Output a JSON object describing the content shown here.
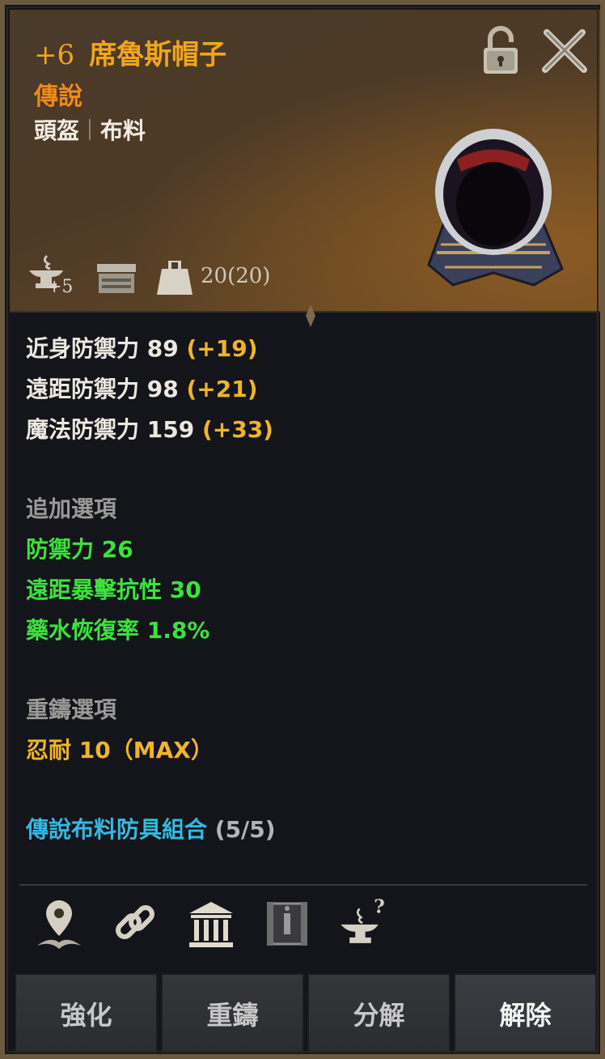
{
  "item": {
    "enhance": "+6",
    "name": "席魯斯帽子",
    "grade": "傳說",
    "category": "頭盔",
    "material": "布料"
  },
  "header_icons": {
    "lock": "padlock-unlocked-icon",
    "close": "close-x-icon"
  },
  "attributes": {
    "reforge_level": "+5",
    "weight_text": "20(20)"
  },
  "stats": {
    "base": [
      {
        "label": "近身防禦力 89",
        "bonus": "(+19)"
      },
      {
        "label": "遠距防禦力 98",
        "bonus": "(+21)"
      },
      {
        "label": "魔法防禦力 159",
        "bonus": "(+33)"
      }
    ],
    "extra_title": "追加選項",
    "extra": [
      "防禦力 26",
      "遠距暴擊抗性 30",
      "藥水恢復率 1.8%"
    ],
    "reforge_title": "重鑄選項",
    "reforge": "忍耐 10（MAX）",
    "set_name": "傳說布料防具組合",
    "set_count": "(5/5)"
  },
  "buttons": {
    "enhance": "強化",
    "reforge": "重鑄",
    "decompose": "分解",
    "unequip": "解除"
  },
  "colors": {
    "title_gold": "#f1a51a",
    "grade_orange": "#f08a1a",
    "bonus_gold": "#f0b42a",
    "option_green": "#3be33b",
    "set_cyan": "#35b8e0"
  }
}
